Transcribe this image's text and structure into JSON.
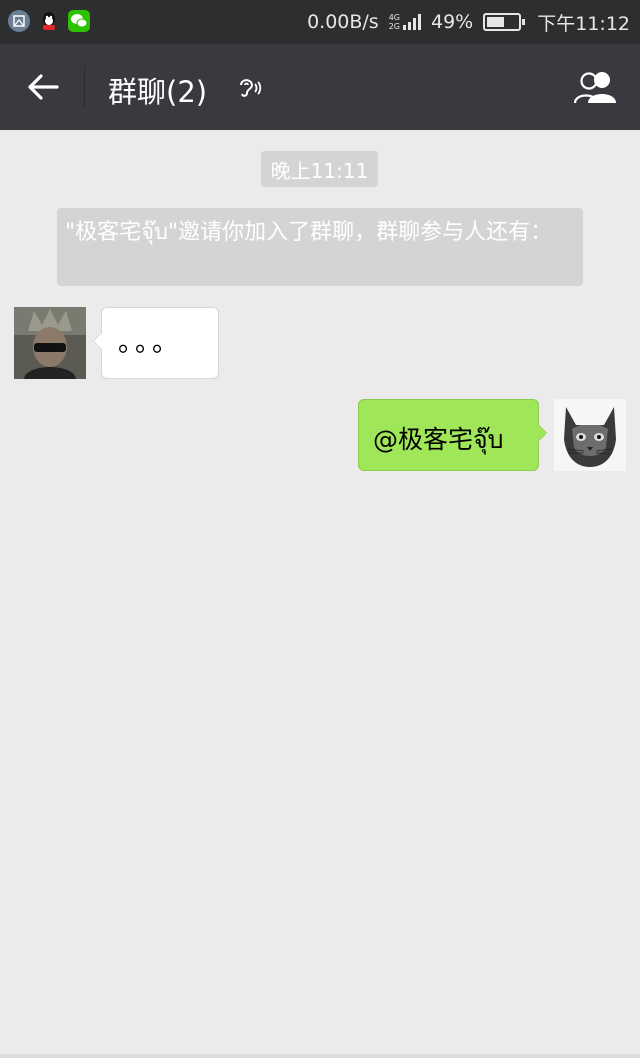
{
  "status_bar": {
    "net_speed": "0.00B/s",
    "net_type_top": "4G",
    "net_type_bottom": "2G",
    "battery": "49%",
    "time": "下午11:12",
    "notification_icons": [
      "gallery-icon",
      "qq-icon",
      "wechat-icon"
    ]
  },
  "header": {
    "title": "群聊(2)",
    "icons": [
      "back-arrow-icon",
      "ear-icon",
      "group-members-icon"
    ]
  },
  "chat": {
    "timestamp": "晚上11:11",
    "system_message": "\"极客宅จุ๊บ\"邀请你加入了群聊，群聊参与人还有：",
    "messages": [
      {
        "direction": "incoming",
        "text": "。。。"
      },
      {
        "direction": "outgoing",
        "text": "@极客宅จุ๊บ"
      }
    ]
  },
  "colors": {
    "status_bar_bg": "#2d2e30",
    "title_bar_bg": "#393a3f",
    "chat_bg": "#ebebeb",
    "outgoing_bubble": "#9fe658",
    "incoming_bubble": "#ffffff",
    "system_pill": "#d4d4d4"
  }
}
